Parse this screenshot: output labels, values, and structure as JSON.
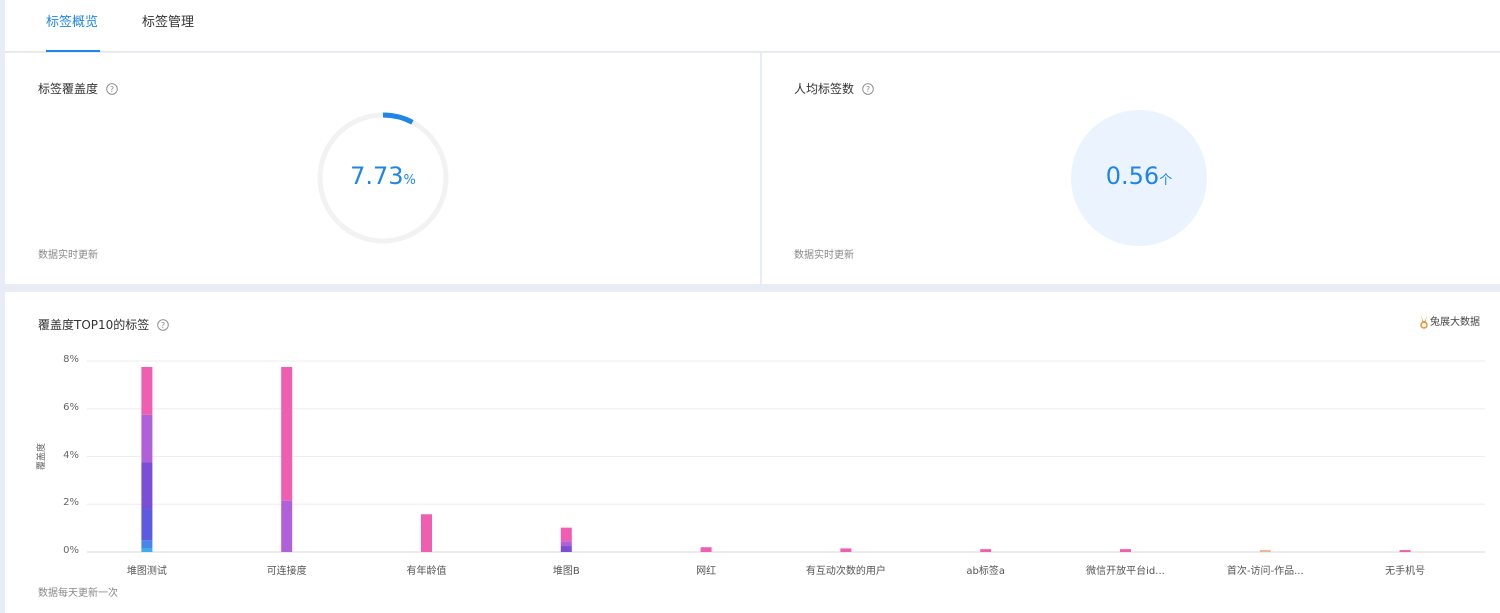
{
  "tabs": [
    {
      "label": "标签概览",
      "active": true
    },
    {
      "label": "标签管理",
      "active": false
    }
  ],
  "coverage_card": {
    "title": "标签覆盖度",
    "value": "7.73",
    "unit": "%",
    "progress_percent": 7.73,
    "footnote": "数据实时更新"
  },
  "avg_card": {
    "title": "人均标签数",
    "value": "0.56",
    "unit": "个",
    "footnote": "数据实时更新"
  },
  "chart_card": {
    "title": "覆盖度TOP10的标签",
    "brand": "兔展大数据",
    "footnote": "数据每天更新一次"
  },
  "colors": {
    "accent": "#1f85e8",
    "ring_track": "#f2f2f2",
    "bubble": "#ebf4fe",
    "pink": "#ef5eb0",
    "purple": "#b060d8",
    "violet": "#7b4ed8",
    "indigo": "#5c5ae0",
    "blue": "#4a86e8",
    "cyan": "#3ab0e8",
    "peach": "#f2b48a"
  },
  "chart_data": {
    "type": "bar",
    "stacked": true,
    "ylabel": "覆盖度",
    "ylim": [
      0,
      8
    ],
    "yticks": [
      "0%",
      "2%",
      "4%",
      "6%",
      "8%"
    ],
    "grid": true,
    "categories": [
      "堆图测试",
      "可连接度",
      "有年龄值",
      "堆图B",
      "网红",
      "有互动次数的用户",
      "ab标签a",
      "微信开放平台id...",
      "首次-访问-作品...",
      "无手机号"
    ],
    "series": [
      {
        "color": "#3ab0e8",
        "values": [
          0.15,
          0,
          0,
          0,
          0,
          0,
          0,
          0,
          0,
          0
        ]
      },
      {
        "color": "#4a86e8",
        "values": [
          0.35,
          0,
          0,
          0,
          0,
          0,
          0,
          0,
          0,
          0
        ]
      },
      {
        "color": "#5c5ae0",
        "values": [
          1.3,
          0,
          0,
          0,
          0,
          0,
          0,
          0,
          0,
          0
        ]
      },
      {
        "color": "#7b4ed8",
        "values": [
          1.95,
          0,
          0,
          0.25,
          0,
          0,
          0,
          0,
          0,
          0
        ]
      },
      {
        "color": "#b060d8",
        "values": [
          2.0,
          2.15,
          0,
          0.2,
          0,
          0,
          0,
          0,
          0,
          0
        ]
      },
      {
        "color": "#ef5eb0",
        "values": [
          2.0,
          5.6,
          1.58,
          0.57,
          0.2,
          0.15,
          0.12,
          0.12,
          0,
          0.08
        ]
      },
      {
        "color": "#f2b48a",
        "values": [
          0,
          0,
          0,
          0,
          0,
          0,
          0,
          0,
          0.08,
          0
        ]
      }
    ]
  }
}
